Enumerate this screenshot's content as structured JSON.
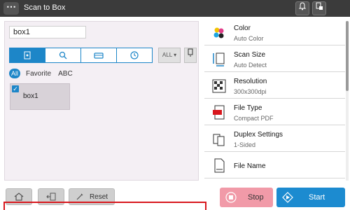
{
  "titlebar": {
    "menu_glyph": "⋯",
    "title": "Scan to Box",
    "icons": [
      "bell-icon",
      "device-status-icon"
    ]
  },
  "left": {
    "search_value": "box1",
    "tabs": [
      "user-box-icon",
      "search-icon",
      "scanner-icon",
      "clock-icon"
    ],
    "all_dropdown": "ALL ▾",
    "filters": {
      "all": "All",
      "favorite": "Favorite",
      "abc": "ABC"
    },
    "box": {
      "name": "box1",
      "checked": true
    }
  },
  "settings": [
    {
      "title": "Color",
      "value": "Auto Color",
      "icon": "color-icon"
    },
    {
      "title": "Scan Size",
      "value": "Auto Detect",
      "icon": "scan-size-icon"
    },
    {
      "title": "Resolution",
      "value": "300x300dpi",
      "icon": "resolution-icon"
    },
    {
      "title": "File Type",
      "value": "Compact PDF",
      "icon": "pdf-file-icon"
    },
    {
      "title": "Duplex Settings",
      "value": "1-Sided",
      "icon": "duplex-icon"
    },
    {
      "title": "File Name",
      "value": "",
      "icon": "file-name-icon"
    }
  ],
  "bottom": {
    "reset_label": "Reset",
    "stop_label": "Stop",
    "start_label": "Start"
  },
  "colors": {
    "accent": "#1d86c8",
    "stop": "#f19aa8",
    "start": "#1c8bd0",
    "highlight": "#d8171d"
  }
}
